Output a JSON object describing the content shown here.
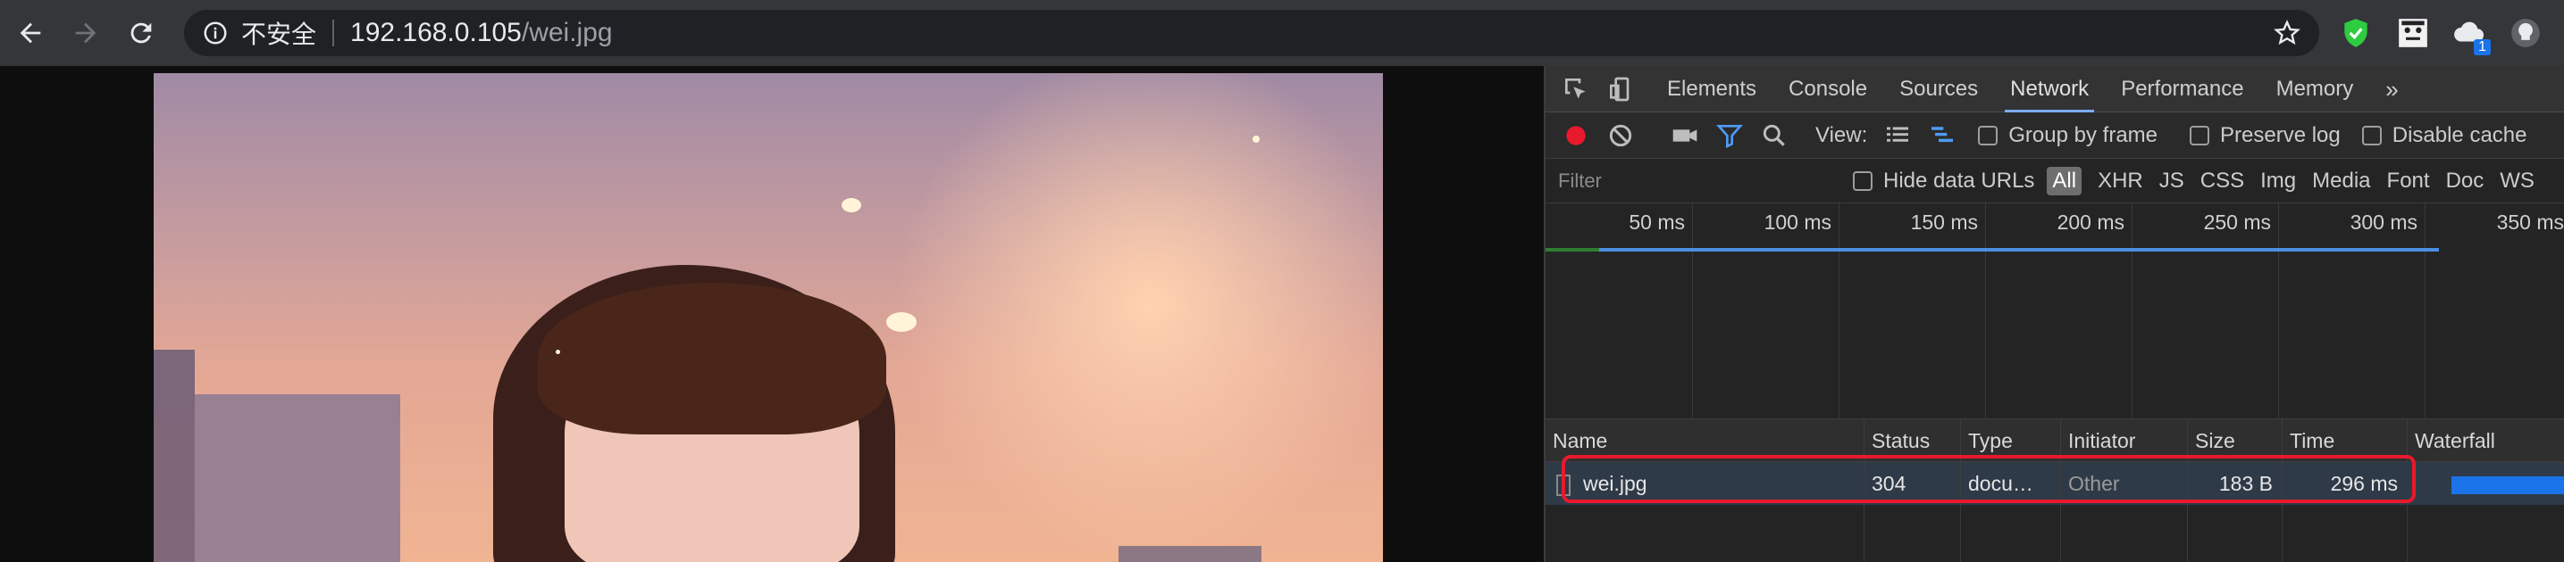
{
  "browser": {
    "security_label": "不安全",
    "url_host": "192.168.0.105",
    "url_path": "/wei.jpg",
    "extension_badge": "1"
  },
  "devtools": {
    "tabs": [
      "Elements",
      "Console",
      "Sources",
      "Network",
      "Performance",
      "Memory"
    ],
    "active_tab": "Network",
    "toolbar": {
      "view_label": "View:",
      "group_by_frame": "Group by frame",
      "preserve_log": "Preserve log",
      "disable_cache": "Disable cache"
    },
    "filter": {
      "placeholder": "Filter",
      "hide_data_urls": "Hide data URLs",
      "types": [
        "All",
        "XHR",
        "JS",
        "CSS",
        "Img",
        "Media",
        "Font",
        "Doc",
        "WS"
      ]
    },
    "timeline_ticks": [
      "50 ms",
      "100 ms",
      "150 ms",
      "200 ms",
      "250 ms",
      "300 ms",
      "350 ms"
    ],
    "columns": [
      "Name",
      "Status",
      "Type",
      "Initiator",
      "Size",
      "Time",
      "Waterfall"
    ],
    "rows": [
      {
        "name": "wei.jpg",
        "status": "304",
        "type": "docu…",
        "initiator": "Other",
        "size": "183 B",
        "time": "296 ms"
      }
    ]
  },
  "colors": {
    "accent": "#7cacf8",
    "record": "#e8192c",
    "highlight": "#e8192c"
  }
}
